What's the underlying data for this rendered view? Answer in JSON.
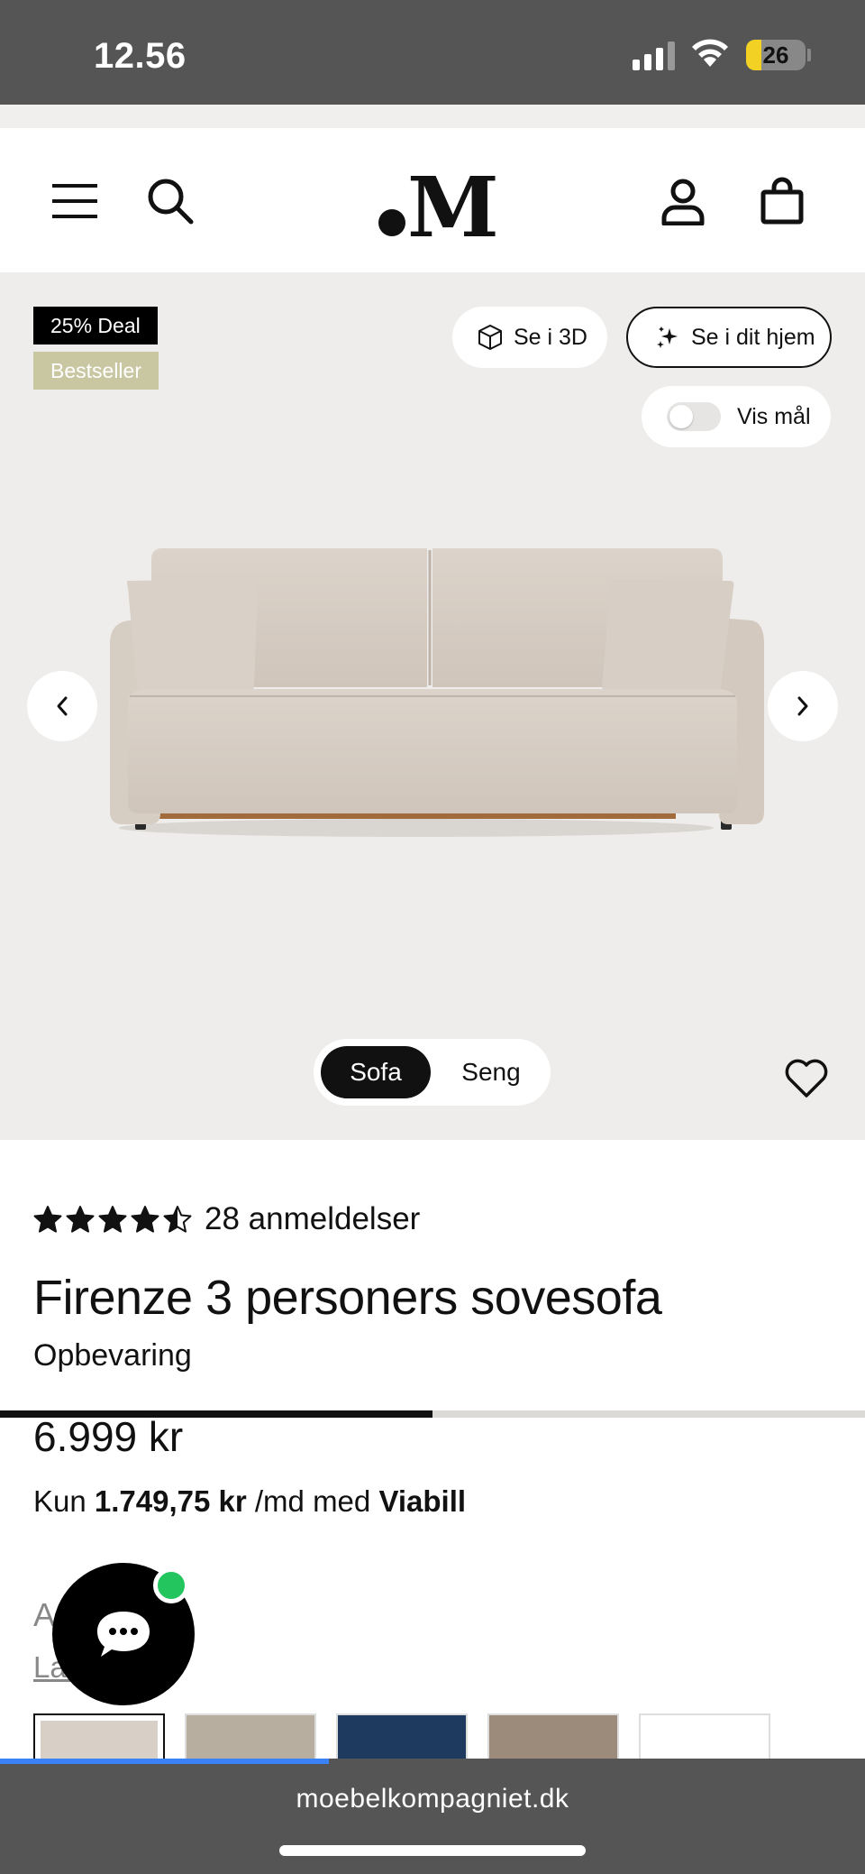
{
  "status_bar": {
    "time": "12.56",
    "battery": "26"
  },
  "header": {
    "logo": "M"
  },
  "gallery": {
    "badges": [
      "25% Deal",
      "Bestseller"
    ],
    "buttons": {
      "view_3d": "Se i 3D",
      "view_home": "Se i dit hjem",
      "show_dims": "Vis mål"
    },
    "toggle_show_dims": false,
    "segment": {
      "options": [
        "Sofa",
        "Seng"
      ],
      "selected": "Sofa"
    },
    "image_progress": 0.5
  },
  "product": {
    "rating": 4.5,
    "reviews": "28 anmeldelser",
    "title": "Firenze 3 personers sovesofa",
    "subtitle": "Opbevaring",
    "price": "6.999 kr",
    "installment": {
      "prefix": "Kun",
      "amount": "1.749,75 kr",
      "middle": "/md med",
      "provider": "Viabill"
    },
    "color_label": "A ge",
    "color_link": "La fet",
    "swatch_colors": [
      "#d8cfc7",
      "#b8aea0",
      "#1e3a5f",
      "#9c8b7a",
      "#ffffff"
    ]
  },
  "browser": {
    "url": "moebelkompagniet.dk",
    "load_progress": 0.38
  },
  "colors": {
    "accent_dark": "#111111",
    "bestseller_bg": "#c9c7a2",
    "online": "#22c55e",
    "link_blue": "#3b82f6"
  }
}
